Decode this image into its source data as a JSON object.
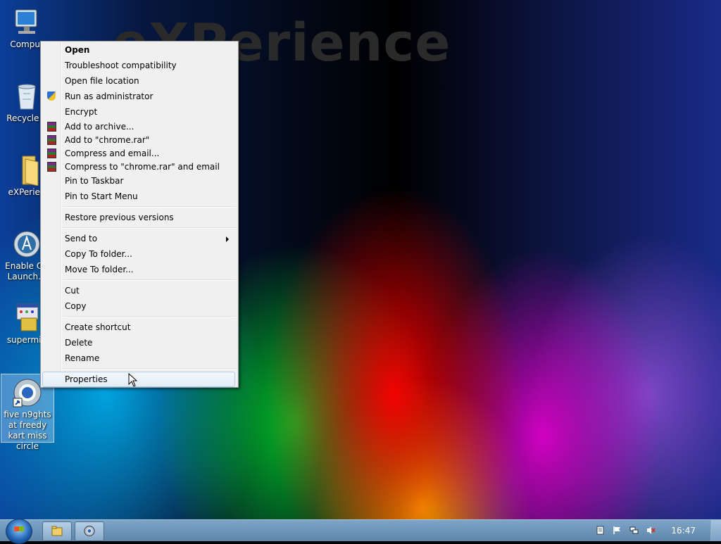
{
  "wallpaper": {
    "title": "eXPerience"
  },
  "desktop_icons": [
    {
      "label": "Comput"
    },
    {
      "label": "Recycle E"
    },
    {
      "label": "eXPerien"
    },
    {
      "label": "Enable Qu\nLaunch.e"
    },
    {
      "label": "supermiu"
    },
    {
      "label": "five n9ghts at freedy kart miss circle"
    }
  ],
  "context_menu": {
    "open": "Open",
    "troubleshoot": "Troubleshoot compatibility",
    "open_location": "Open file location",
    "run_admin": "Run as administrator",
    "encrypt": "Encrypt",
    "add_archive": "Add to archive...",
    "add_rar": "Add to \"chrome.rar\"",
    "compress_email": "Compress and email...",
    "compress_rar_email": "Compress to \"chrome.rar\" and email",
    "pin_taskbar": "Pin to Taskbar",
    "pin_start": "Pin to Start Menu",
    "restore": "Restore previous versions",
    "send_to": "Send to",
    "copy_to": "Copy To folder...",
    "move_to": "Move To folder...",
    "cut": "Cut",
    "copy": "Copy",
    "create_shortcut": "Create shortcut",
    "delete": "Delete",
    "rename": "Rename",
    "properties": "Properties"
  },
  "taskbar": {
    "clock": "16:47"
  },
  "colors": {
    "menu_bg": "#f0f0f0",
    "hover_border": "#aeccee",
    "taskbar": "#6f95b8"
  }
}
